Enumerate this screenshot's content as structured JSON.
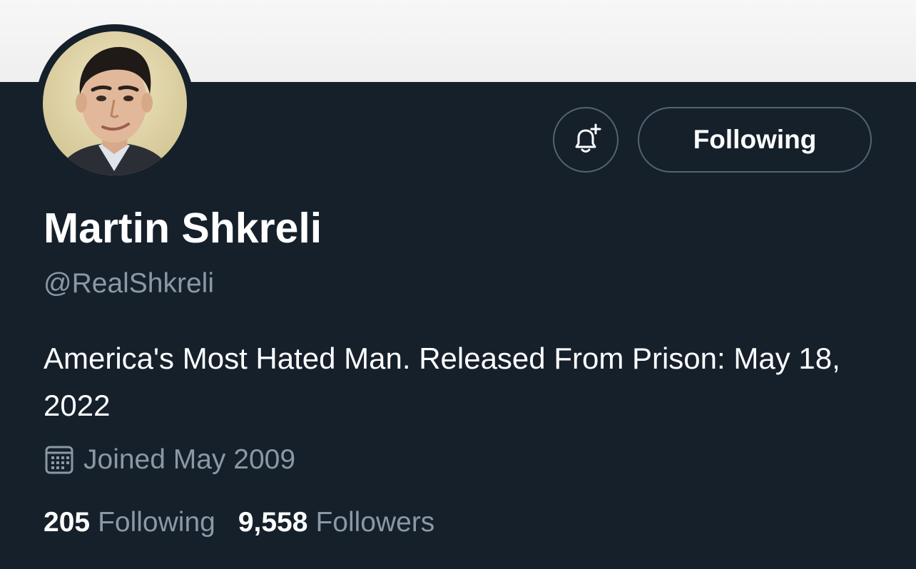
{
  "profile": {
    "display_name": "Martin Shkreli",
    "handle": "@RealShkreli",
    "bio": "America's Most Hated Man. Released From Prison: May 18, 2022",
    "joined": "Joined May 2009",
    "avatar_icon": "profile-photo"
  },
  "actions": {
    "notify_icon": "bell-plus-icon",
    "follow_state_label": "Following"
  },
  "stats": {
    "following_count": "205",
    "following_label": "Following",
    "followers_count": "9,558",
    "followers_label": "Followers"
  },
  "colors": {
    "background": "#15202b",
    "primary_text": "#ffffff",
    "secondary_text": "#8b98a5",
    "border": "#536471",
    "banner": "#f2f2f2"
  }
}
